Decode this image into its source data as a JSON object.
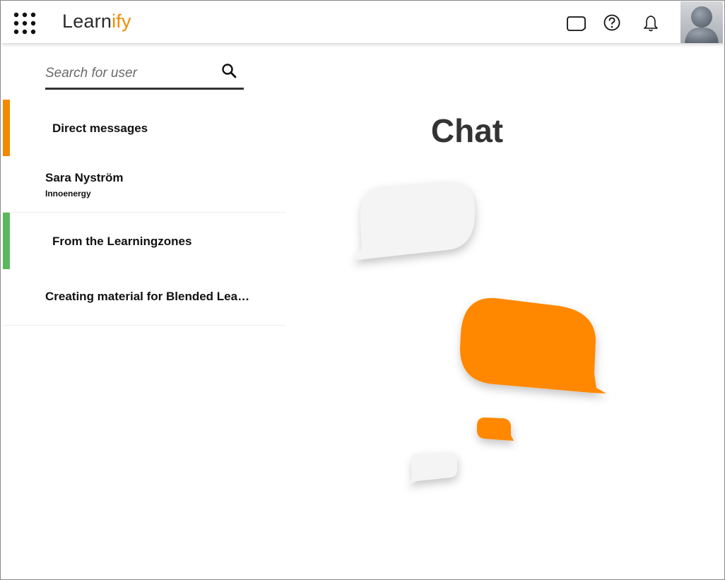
{
  "app": {
    "logo_part1": "Learn",
    "logo_part2": "ify",
    "brand_color": "#f28a00",
    "dark_color": "#2b2b2b"
  },
  "topbar": {
    "icons": [
      "apps-grid-icon",
      "chat-bubble-icon",
      "help-circle-icon",
      "bell-icon",
      "user-avatar"
    ]
  },
  "search": {
    "placeholder": "Search for user",
    "value": ""
  },
  "sections": {
    "direct_messages": {
      "label": "Direct messages",
      "accent_color": "#f28a00"
    },
    "learningzones": {
      "label": "From the Learningzones",
      "accent_color": "#5cb85c"
    }
  },
  "conversations": {
    "direct": [
      {
        "name": "Sara Nyström",
        "subtitle": "Innoenergy"
      }
    ],
    "learningzones": [
      {
        "name": "Creating material for Blended Lea…"
      }
    ]
  },
  "main": {
    "title": "Chat"
  }
}
